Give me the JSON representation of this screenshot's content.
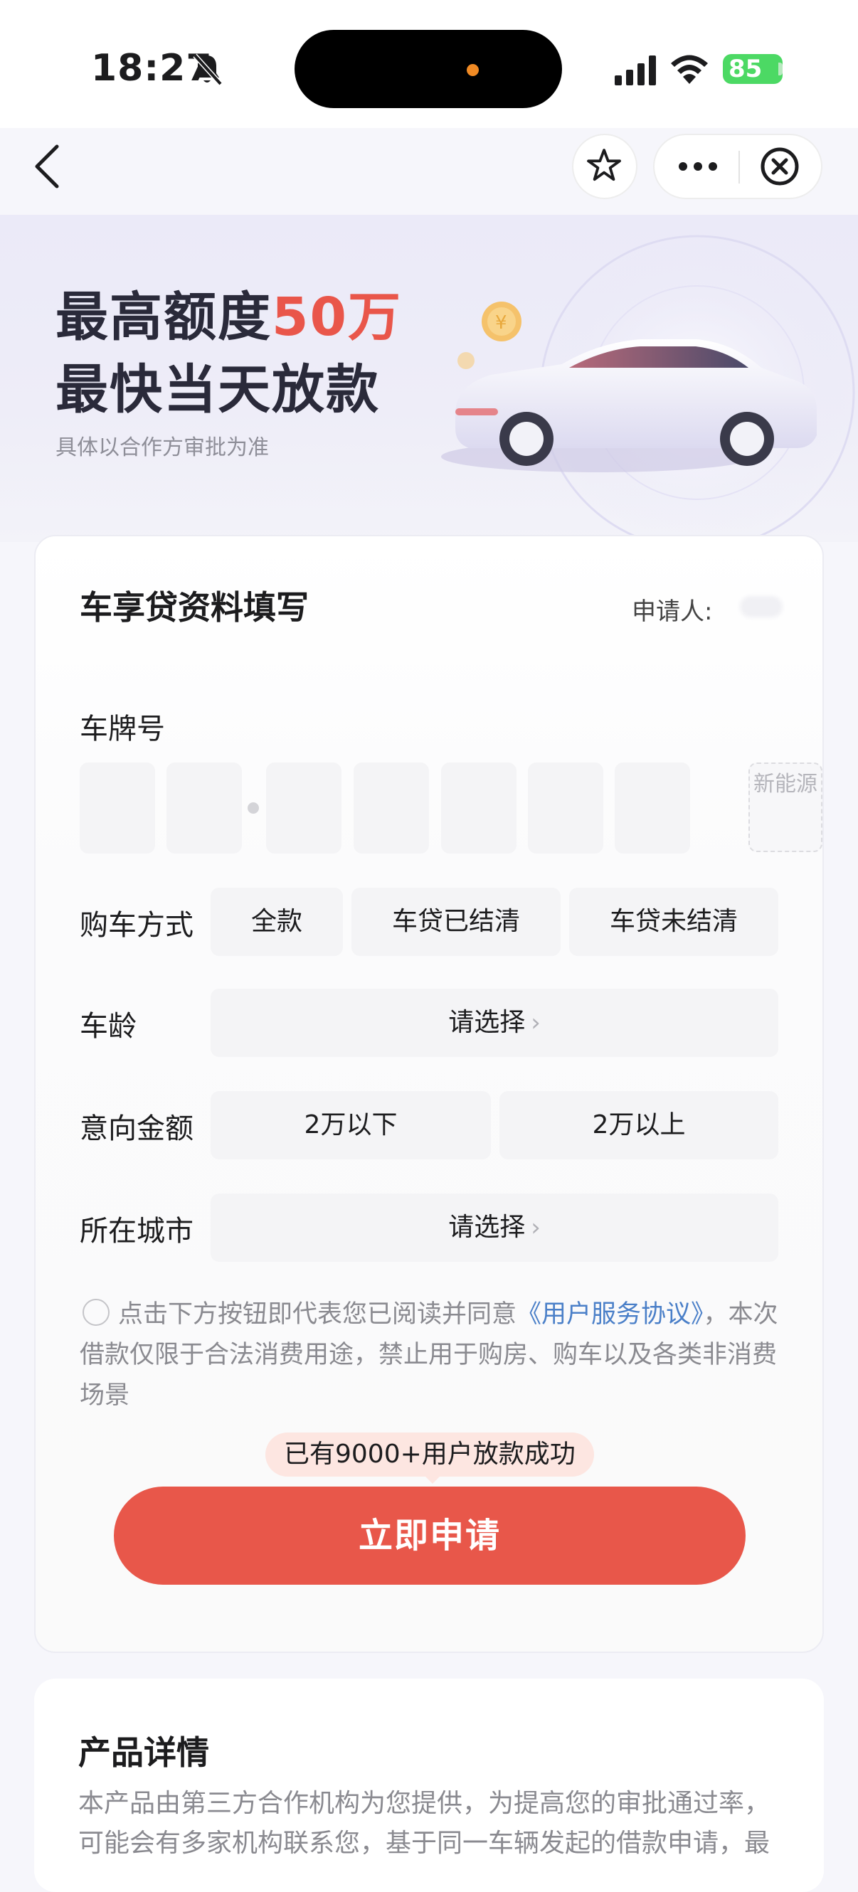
{
  "status_bar": {
    "time": "18:27",
    "battery": "85"
  },
  "hero": {
    "title_line1_prefix": "最高额度",
    "title_line1_accent": "50万",
    "title_line2": "最快当天放款",
    "subtitle": "具体以合作方审批为准"
  },
  "form": {
    "title": "车享贷资料填写",
    "applicant_label": "申请人:",
    "plate": {
      "label": "车牌号",
      "new_energy": "新能源"
    },
    "purchase": {
      "label": "购车方式",
      "options": [
        "全款",
        "车贷已结清",
        "车贷未结清"
      ]
    },
    "car_age": {
      "label": "车龄",
      "placeholder": "请选择"
    },
    "amount": {
      "label": "意向金额",
      "options": [
        "2万以下",
        "2万以上"
      ]
    },
    "city": {
      "label": "所在城市",
      "placeholder": "请选择"
    },
    "agreement": {
      "prefix": "点击下方按钮即代表您已阅读并同意",
      "link": "《用户服务协议》",
      "suffix": "，本次借款仅限于合法消费用途，禁止用于购房、购车以及各类非消费场景"
    },
    "tip": "已有9000+用户放款成功",
    "submit": "立即申请"
  },
  "detail": {
    "title": "产品详情",
    "text": "本产品由第三方合作机构为您提供，为提高您的审批通过率，可能会有多家机构联系您，基于同一车辆发起的借款申请，最"
  },
  "colors": {
    "accent": "#e8574a",
    "link": "#4a7fc8",
    "tip_bg": "#fde6e1"
  }
}
